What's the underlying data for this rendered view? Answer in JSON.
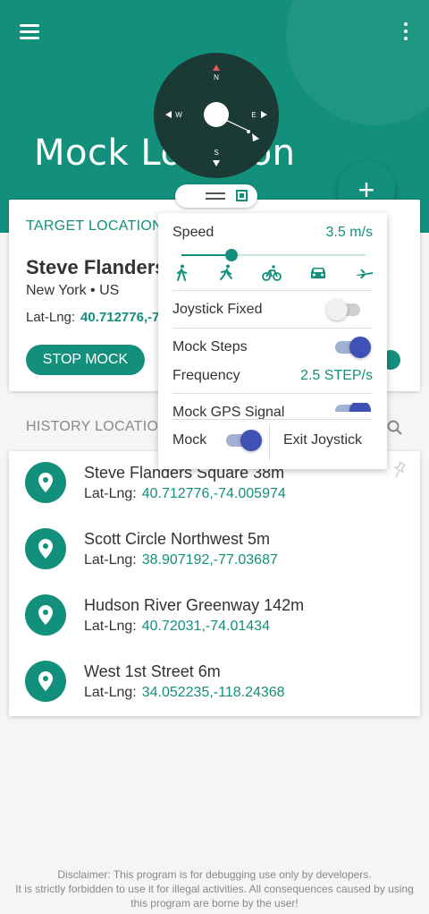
{
  "header": {
    "title": "Mock Location",
    "accent_color": "#13907c",
    "menu_icon": "hamburger-icon",
    "more_icon": "more-vert-icon"
  },
  "compass": {
    "north": "N",
    "east": "E",
    "south": "S",
    "west": "W"
  },
  "fab": {
    "label": "+"
  },
  "target": {
    "section_label": "TARGET LOCATION",
    "name": "Steve Flanders Square",
    "region": "New York  •  US",
    "latlng_label": "Lat-Lng:",
    "latlng_value": "40.712776,-74.005974",
    "stop_button": "STOP MOCK"
  },
  "joystick_panel": {
    "speed_label": "Speed",
    "speed_value": "3.5 m/s",
    "speed_fraction": 0.27,
    "modes": [
      "walk-icon",
      "run-icon",
      "bike-icon",
      "car-icon",
      "plane-icon"
    ],
    "joystick_fixed_label": "Joystick Fixed",
    "joystick_fixed_on": false,
    "mock_steps_label": "Mock Steps",
    "mock_steps_on": true,
    "frequency_label": "Frequency",
    "frequency_value": "2.5  STEP/s",
    "mock_gps_label": "Mock GPS Signal",
    "mock_gps_on": true,
    "mock_label": "Mock",
    "mock_on": true,
    "exit_label": "Exit Joystick"
  },
  "history": {
    "section_label": "HISTORY LOCATION",
    "latlng_label": "Lat-Lng:",
    "items": [
      {
        "name": "Steve Flanders Square 38m",
        "latlng": "40.712776,-74.005974"
      },
      {
        "name": "Scott Circle Northwest 5m",
        "latlng": "38.907192,-77.03687"
      },
      {
        "name": "Hudson River Greenway 142m",
        "latlng": "40.72031,-74.01434"
      },
      {
        "name": "West 1st Street 6m",
        "latlng": "34.052235,-118.24368"
      }
    ]
  },
  "disclaimer": {
    "line1": "Disclaimer: This program is for debugging use only by developers.",
    "line2": "It is strictly forbidden to use it for illegal activities. All consequences caused by using",
    "line3": "this program are borne by the user!"
  }
}
